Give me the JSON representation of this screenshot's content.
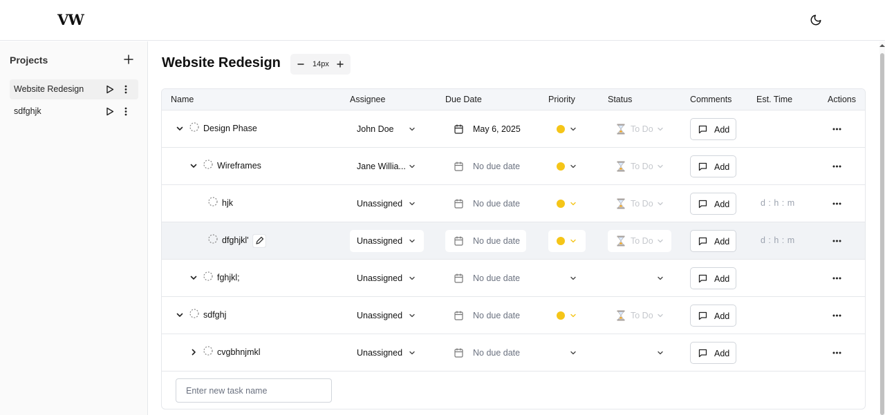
{
  "header": {
    "logo": "VW",
    "theme_icon": "moon-icon"
  },
  "sidebar": {
    "title": "Projects",
    "projects": [
      {
        "label": "Website Redesign",
        "active": true
      },
      {
        "label": "sdfghjk",
        "active": false
      }
    ]
  },
  "main": {
    "title": "Website Redesign",
    "zoom": "14px",
    "columns": [
      "Name",
      "Assignee",
      "Due Date",
      "Priority",
      "Status",
      "Comments",
      "Est. Time",
      "Actions"
    ],
    "rows": [
      {
        "name": "Design Phase",
        "level": 0,
        "chevron": "down",
        "assignee": "John Doe",
        "due": "May 6, 2025",
        "has_due": true,
        "priority": true,
        "status": "To Do",
        "comment": "Add",
        "est": ""
      },
      {
        "name": "Wireframes",
        "level": 1,
        "chevron": "down",
        "assignee": "Jane Willia...",
        "due": "No due date",
        "has_due": false,
        "priority": true,
        "status": "To Do",
        "comment": "Add",
        "est": ""
      },
      {
        "name": "hjk",
        "level": 2,
        "chevron": "",
        "assignee": "Unassigned",
        "due": "No due date",
        "has_due": false,
        "priority": true,
        "status": "To Do",
        "comment": "Add",
        "est": "d : h : m"
      },
      {
        "name": "dfghjkl'",
        "level": 2,
        "chevron": "",
        "assignee": "Unassigned",
        "due": "No due date",
        "has_due": false,
        "priority": true,
        "status": "To Do",
        "comment": "Add",
        "est": "d : h : m",
        "highlighted": true
      },
      {
        "name": "fghjkl;",
        "level": 1,
        "chevron": "down",
        "assignee": "Unassigned",
        "due": "No due date",
        "has_due": false,
        "priority": false,
        "status": "",
        "comment": "Add",
        "est": ""
      },
      {
        "name": "sdfghj",
        "level": 0,
        "chevron": "down",
        "assignee": "Unassigned",
        "due": "No due date",
        "has_due": false,
        "priority": true,
        "status": "To Do",
        "comment": "Add",
        "est": ""
      },
      {
        "name": "cvgbhnjmkl",
        "level": 1,
        "chevron": "right",
        "assignee": "Unassigned",
        "due": "No due date",
        "has_due": false,
        "priority": false,
        "status": "",
        "comment": "Add",
        "est": ""
      }
    ],
    "new_task_placeholder": "Enter new task name"
  },
  "colors": {
    "priority_medium": "#f5c518",
    "due_muted": "#6b7280",
    "row_highlight": "#f1f3f6"
  }
}
